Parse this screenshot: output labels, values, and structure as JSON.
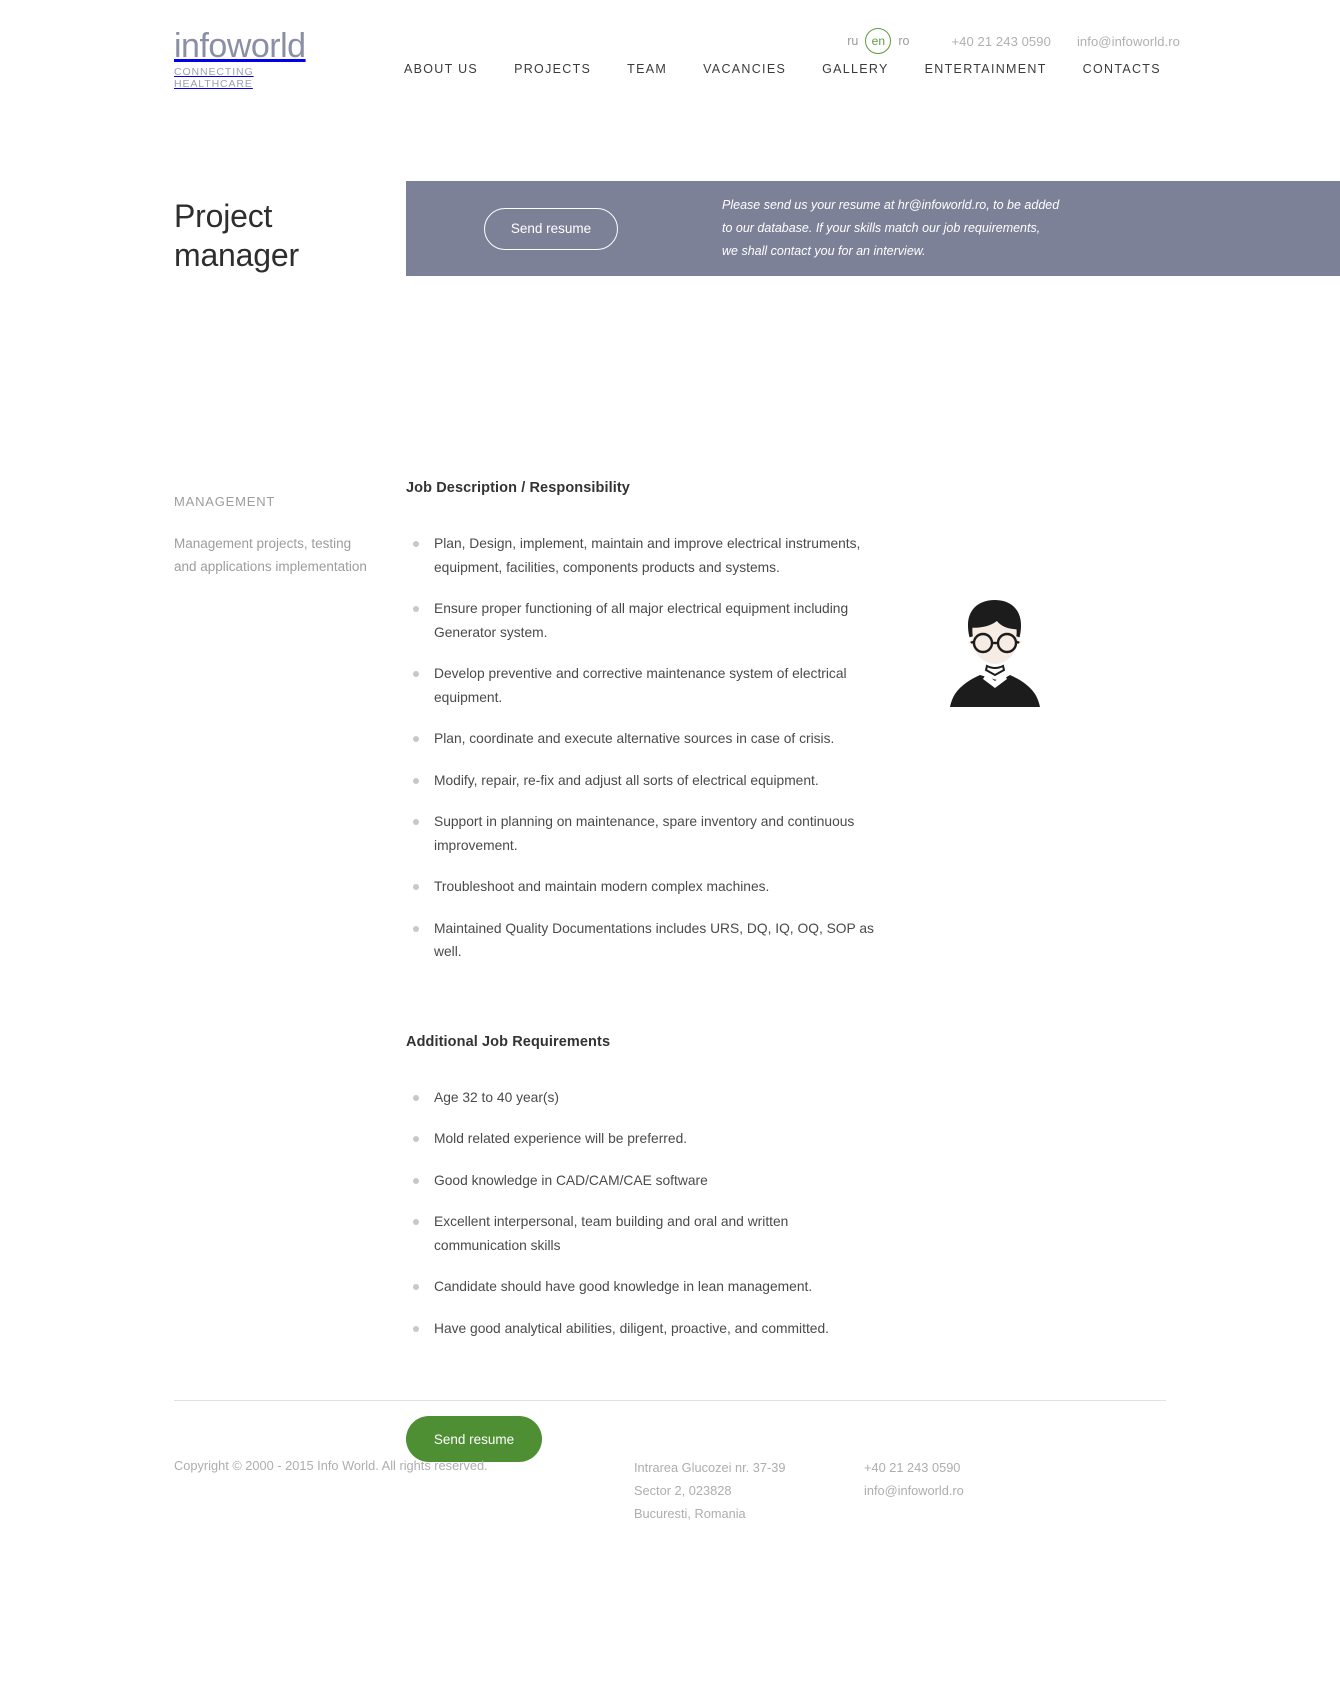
{
  "brand": {
    "name": "infoworld",
    "tagline": "CONNECTING HEALTHCARE"
  },
  "topbar": {
    "lang_ru": "ru",
    "lang_en": "en",
    "lang_ro": "ro",
    "phone": "+40 21 243 0590",
    "email": "info@infoworld.ro"
  },
  "nav": {
    "items": [
      {
        "label": "ABOUT US"
      },
      {
        "label": "PROJECTS"
      },
      {
        "label": "TEAM"
      },
      {
        "label": "VACANCIES"
      },
      {
        "label": "GALLERY"
      },
      {
        "label": "ENTERTAINMENT"
      },
      {
        "label": "CONTACTS"
      }
    ]
  },
  "hero": {
    "title": "Project manager",
    "send_resume_label": "Send resume",
    "note_line1": "Please send us your resume at hr@infoworld.ro, to be added",
    "note_line2": "to our database. If your skills match our job requirements,",
    "note_line3": "we shall contact you for an interview.",
    "band_color": "#7d8198"
  },
  "sidebar": {
    "category": "MANAGEMENT",
    "description": "Management projects, testing and applications implementation"
  },
  "job": {
    "description_title": "Job Description / Responsibility",
    "description_items": [
      "Plan, Design, implement, maintain and improve electrical instruments, equipment, facilities, components products and systems.",
      "Ensure proper functioning of all major electrical equipment including Generator system.",
      "Develop preventive and corrective maintenance system of electrical equipment.",
      "Plan, coordinate and execute alternative sources in case of crisis.",
      "Modify, repair, re-fix and adjust all sorts of electrical equipment.",
      "Support in planning on maintenance, spare inventory and continuous improvement.",
      "Troubleshoot and maintain modern complex machines.",
      "Maintained Quality Documentations includes URS, DQ, IQ, OQ, SOP as well."
    ],
    "requirements_title": "Additional Job Requirements",
    "requirements_items": [
      "Age 32 to 40 year(s)",
      "Mold related experience will be preferred.",
      "Good knowledge in CAD/CAM/CAE software",
      "Excellent interpersonal, team building and oral and written communication skills",
      "Candidate should have good knowledge in lean management.",
      "Have good analytical abilities, diligent, proactive, and committed."
    ]
  },
  "cta": {
    "send_resume_label": "Send resume",
    "color": "#4f8f33"
  },
  "footer": {
    "copyright": "Copyright © 2000 - 2015 Info World. All rights reserved.",
    "address_line1": "Intrarea Glucozei nr. 37-39",
    "address_line2": "Sector 2, 023828",
    "address_line3": "Bucuresti, Romania",
    "phone": "+40 21 243 0590",
    "email": "info@infoworld.ro"
  }
}
